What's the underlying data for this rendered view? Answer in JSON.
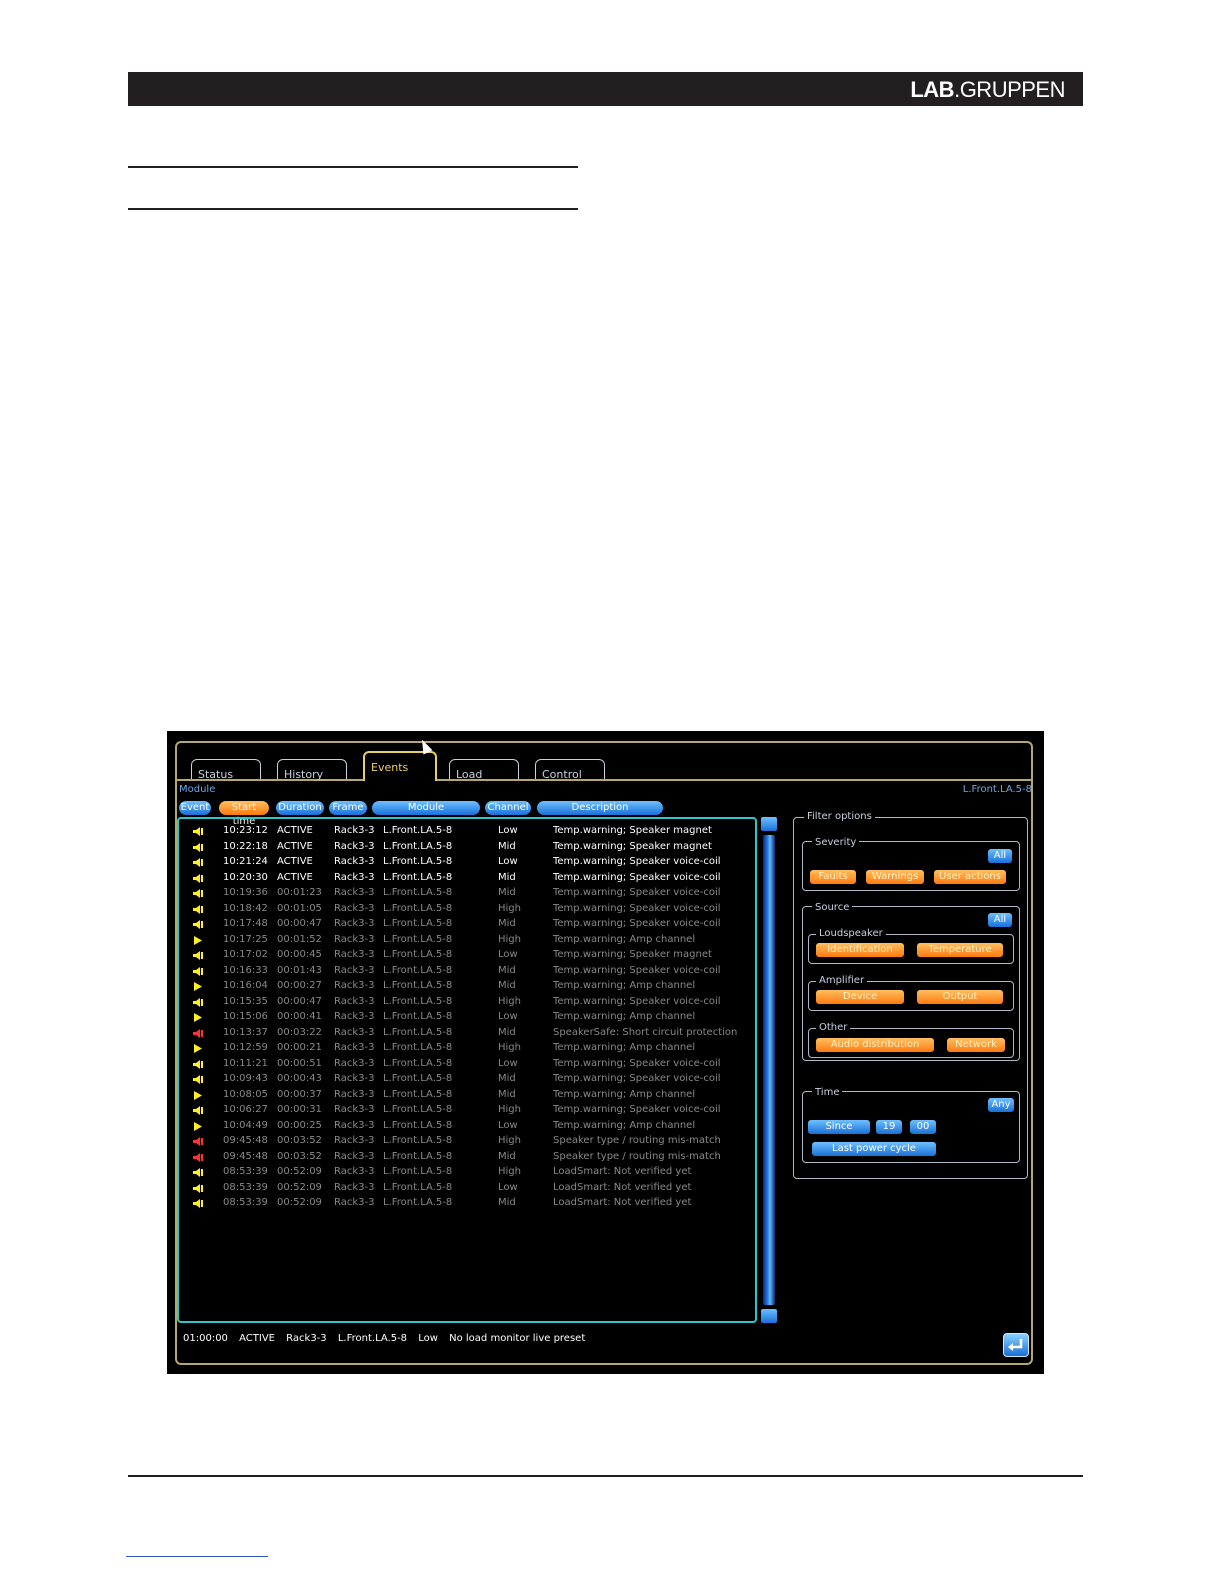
{
  "brand": {
    "part1": "LAB",
    "part2": ".GRUPPEN"
  },
  "tabs": [
    {
      "label": "Status"
    },
    {
      "label": "History"
    },
    {
      "label": "Events"
    },
    {
      "label": "Load"
    },
    {
      "label": "Control"
    }
  ],
  "module_label": "Module",
  "module_name": "L.Front.LA.5-8",
  "columns": {
    "event": "Event",
    "start_time": "Start time",
    "duration": "Duration",
    "frame": "Frame",
    "module": "Module",
    "channel": "Channel",
    "description": "Description"
  },
  "icon_colors": {
    "yellow": "#ffee22",
    "red": "#ff3030"
  },
  "events": [
    {
      "icon": "speaker-icon",
      "color": "yellow",
      "bright": true,
      "start": "10:23:12",
      "duration": "ACTIVE",
      "frame": "Rack3-3",
      "module": "L.Front.LA.5-8",
      "channel": "Low",
      "description": "Temp.warning; Speaker magnet"
    },
    {
      "icon": "speaker-icon",
      "color": "yellow",
      "bright": true,
      "start": "10:22:18",
      "duration": "ACTIVE",
      "frame": "Rack3-3",
      "module": "L.Front.LA.5-8",
      "channel": "Mid",
      "description": "Temp.warning; Speaker magnet"
    },
    {
      "icon": "speaker-icon",
      "color": "yellow",
      "bright": true,
      "start": "10:21:24",
      "duration": "ACTIVE",
      "frame": "Rack3-3",
      "module": "L.Front.LA.5-8",
      "channel": "Low",
      "description": "Temp.warning; Speaker voice-coil"
    },
    {
      "icon": "speaker-icon",
      "color": "yellow",
      "bright": true,
      "start": "10:20:30",
      "duration": "ACTIVE",
      "frame": "Rack3-3",
      "module": "L.Front.LA.5-8",
      "channel": "Mid",
      "description": "Temp.warning; Speaker voice-coil"
    },
    {
      "icon": "speaker-icon",
      "color": "yellow",
      "bright": false,
      "start": "10:19:36",
      "duration": "00:01:23",
      "frame": "Rack3-3",
      "module": "L.Front.LA.5-8",
      "channel": "Mid",
      "description": "Temp.warning; Speaker voice-coil"
    },
    {
      "icon": "speaker-icon",
      "color": "yellow",
      "bright": false,
      "start": "10:18:42",
      "duration": "00:01:05",
      "frame": "Rack3-3",
      "module": "L.Front.LA.5-8",
      "channel": "High",
      "description": "Temp.warning; Speaker voice-coil"
    },
    {
      "icon": "speaker-icon",
      "color": "yellow",
      "bright": false,
      "start": "10:17:48",
      "duration": "00:00:47",
      "frame": "Rack3-3",
      "module": "L.Front.LA.5-8",
      "channel": "Mid",
      "description": "Temp.warning; Speaker voice-coil"
    },
    {
      "icon": "amp-icon",
      "color": "yellow",
      "bright": false,
      "start": "10:17:25",
      "duration": "00:01:52",
      "frame": "Rack3-3",
      "module": "L.Front.LA.5-8",
      "channel": "High",
      "description": "Temp.warning; Amp channel"
    },
    {
      "icon": "speaker-icon",
      "color": "yellow",
      "bright": false,
      "start": "10:17:02",
      "duration": "00:00:45",
      "frame": "Rack3-3",
      "module": "L.Front.LA.5-8",
      "channel": "Low",
      "description": "Temp.warning; Speaker magnet"
    },
    {
      "icon": "speaker-icon",
      "color": "yellow",
      "bright": false,
      "start": "10:16:33",
      "duration": "00:01:43",
      "frame": "Rack3-3",
      "module": "L.Front.LA.5-8",
      "channel": "Mid",
      "description": "Temp.warning; Speaker voice-coil"
    },
    {
      "icon": "amp-icon",
      "color": "yellow",
      "bright": false,
      "start": "10:16:04",
      "duration": "00:00:27",
      "frame": "Rack3-3",
      "module": "L.Front.LA.5-8",
      "channel": "Mid",
      "description": "Temp.warning; Amp channel"
    },
    {
      "icon": "speaker-icon",
      "color": "yellow",
      "bright": false,
      "start": "10:15:35",
      "duration": "00:00:47",
      "frame": "Rack3-3",
      "module": "L.Front.LA.5-8",
      "channel": "High",
      "description": "Temp.warning; Speaker voice-coil"
    },
    {
      "icon": "amp-icon",
      "color": "yellow",
      "bright": false,
      "start": "10:15:06",
      "duration": "00:00:41",
      "frame": "Rack3-3",
      "module": "L.Front.LA.5-8",
      "channel": "Low",
      "description": "Temp.warning; Amp channel"
    },
    {
      "icon": "speaker-icon",
      "color": "red",
      "bright": false,
      "start": "10:13:37",
      "duration": "00:03:22",
      "frame": "Rack3-3",
      "module": "L.Front.LA.5-8",
      "channel": "Mid",
      "description": "SpeakerSafe: Short circuit protection"
    },
    {
      "icon": "amp-icon",
      "color": "yellow",
      "bright": false,
      "start": "10:12:59",
      "duration": "00:00:21",
      "frame": "Rack3-3",
      "module": "L.Front.LA.5-8",
      "channel": "High",
      "description": "Temp.warning; Amp channel"
    },
    {
      "icon": "speaker-icon",
      "color": "yellow",
      "bright": false,
      "start": "10:11:21",
      "duration": "00:00:51",
      "frame": "Rack3-3",
      "module": "L.Front.LA.5-8",
      "channel": "Low",
      "description": "Temp.warning; Speaker voice-coil"
    },
    {
      "icon": "speaker-icon",
      "color": "yellow",
      "bright": false,
      "start": "10:09:43",
      "duration": "00:00:43",
      "frame": "Rack3-3",
      "module": "L.Front.LA.5-8",
      "channel": "Mid",
      "description": "Temp.warning; Speaker voice-coil"
    },
    {
      "icon": "amp-icon",
      "color": "yellow",
      "bright": false,
      "start": "10:08:05",
      "duration": "00:00:37",
      "frame": "Rack3-3",
      "module": "L.Front.LA.5-8",
      "channel": "Mid",
      "description": "Temp.warning; Amp channel"
    },
    {
      "icon": "speaker-icon",
      "color": "yellow",
      "bright": false,
      "start": "10:06:27",
      "duration": "00:00:31",
      "frame": "Rack3-3",
      "module": "L.Front.LA.5-8",
      "channel": "High",
      "description": "Temp.warning; Speaker voice-coil"
    },
    {
      "icon": "amp-icon",
      "color": "yellow",
      "bright": false,
      "start": "10:04:49",
      "duration": "00:00:25",
      "frame": "Rack3-3",
      "module": "L.Front.LA.5-8",
      "channel": "Low",
      "description": "Temp.warning; Amp channel"
    },
    {
      "icon": "speaker-icon",
      "color": "red",
      "bright": false,
      "start": "09:45:48",
      "duration": "00:03:52",
      "frame": "Rack3-3",
      "module": "L.Front.LA.5-8",
      "channel": "High",
      "description": "Speaker type / routing mis-match"
    },
    {
      "icon": "speaker-icon",
      "color": "red",
      "bright": false,
      "start": "09:45:48",
      "duration": "00:03:52",
      "frame": "Rack3-3",
      "module": "L.Front.LA.5-8",
      "channel": "Mid",
      "description": "Speaker type / routing mis-match"
    },
    {
      "icon": "speaker-icon",
      "color": "yellow",
      "bright": false,
      "start": "08:53:39",
      "duration": "00:52:09",
      "frame": "Rack3-3",
      "module": "L.Front.LA.5-8",
      "channel": "High",
      "description": "LoadSmart: Not verified yet"
    },
    {
      "icon": "speaker-icon",
      "color": "yellow",
      "bright": false,
      "start": "08:53:39",
      "duration": "00:52:09",
      "frame": "Rack3-3",
      "module": "L.Front.LA.5-8",
      "channel": "Low",
      "description": "LoadSmart: Not verified yet"
    },
    {
      "icon": "speaker-icon",
      "color": "yellow",
      "bright": false,
      "start": "08:53:39",
      "duration": "00:52:09",
      "frame": "Rack3-3",
      "module": "L.Front.LA.5-8",
      "channel": "Mid",
      "description": "LoadSmart: Not verified yet"
    }
  ],
  "filter": {
    "title": "Filter options",
    "severity": {
      "label": "Severity",
      "all": "All",
      "faults": "Faults",
      "warnings": "Warnings",
      "user_actions": "User actions"
    },
    "source": {
      "label": "Source",
      "all": "All",
      "loudspeaker": {
        "label": "Loudspeaker",
        "identification": "Identification",
        "temperature": "Temperature"
      },
      "amplifier": {
        "label": "Amplifier",
        "device": "Device",
        "output": "Output"
      },
      "other": {
        "label": "Other",
        "audio_distribution": "Audio distribution",
        "network": "Network"
      }
    },
    "time": {
      "label": "Time",
      "any": "Any",
      "since": "Since",
      "hour": "19",
      "minute": "00",
      "last_power_cycle": "Last power cycle"
    }
  },
  "status_line": {
    "start": "01:00:00",
    "duration": "ACTIVE",
    "frame": "Rack3-3",
    "module": "L.Front.LA.5-8",
    "channel": "Low",
    "description": "No load monitor live preset"
  }
}
